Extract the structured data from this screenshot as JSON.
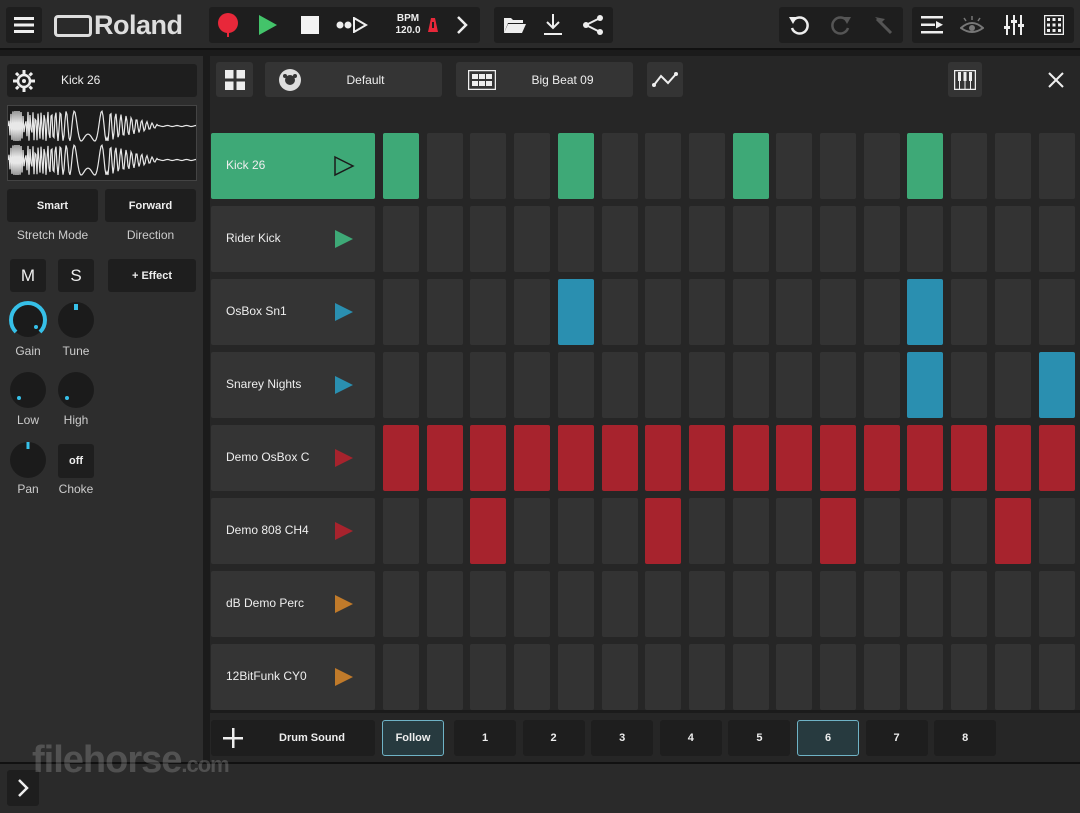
{
  "app": {
    "logo_text": "Roland"
  },
  "transport": {
    "bpm_label": "BPM",
    "bpm_value": "120.0"
  },
  "sound_panel": {
    "sample_name": "Kick 26",
    "stretch_mode_value": "Smart",
    "stretch_mode_label": "Stretch Mode",
    "direction_value": "Forward",
    "direction_label": "Direction",
    "mute_label": "M",
    "solo_label": "S",
    "effect_label": "+ Effect",
    "knobs": {
      "gain": "Gain",
      "tune": "Tune",
      "low": "Low",
      "high": "High",
      "pan": "Pan",
      "choke": "Choke"
    },
    "choke_value": "off"
  },
  "editor_header": {
    "kit_name": "Default",
    "pattern_name": "Big Beat 09"
  },
  "tracks": [
    {
      "name": "Kick 26",
      "color": "#3ea977",
      "steps": [
        1,
        0,
        0,
        0,
        1,
        0,
        0,
        0,
        1,
        0,
        0,
        0,
        1,
        0,
        0,
        0
      ],
      "cls": "on-green"
    },
    {
      "name": "Rider Kick",
      "color": "#3ea977",
      "steps": [
        0,
        0,
        0,
        0,
        0,
        0,
        0,
        0,
        0,
        0,
        0,
        0,
        0,
        0,
        0,
        0
      ],
      "cls": "on-green"
    },
    {
      "name": "OsBox Sn1",
      "color": "#2a8fb0",
      "steps": [
        0,
        0,
        0,
        0,
        1,
        0,
        0,
        0,
        0,
        0,
        0,
        0,
        1,
        0,
        0,
        0
      ],
      "cls": "on-blue"
    },
    {
      "name": "Snarey Nights",
      "color": "#2a8fb0",
      "steps": [
        0,
        0,
        0,
        0,
        0,
        0,
        0,
        0,
        0,
        0,
        0,
        0,
        1,
        0,
        0,
        1
      ],
      "cls": "on-blue"
    },
    {
      "name": "Demo OsBox C",
      "color": "#a7232d",
      "steps": [
        1,
        1,
        1,
        1,
        1,
        1,
        1,
        1,
        1,
        1,
        1,
        1,
        1,
        1,
        1,
        1
      ],
      "cls": "on-red"
    },
    {
      "name": "Demo 808 CH4",
      "color": "#a7232d",
      "steps": [
        0,
        0,
        1,
        0,
        0,
        0,
        1,
        0,
        0,
        0,
        1,
        0,
        0,
        0,
        1,
        0
      ],
      "cls": "on-red"
    },
    {
      "name": "dB Demo Perc",
      "color": "#c07a2a",
      "steps": [
        0,
        0,
        0,
        0,
        0,
        0,
        0,
        0,
        0,
        0,
        0,
        0,
        0,
        0,
        0,
        0
      ],
      "cls": "on-red"
    },
    {
      "name": "12BitFunk CY0",
      "color": "#c07a2a",
      "steps": [
        0,
        0,
        0,
        0,
        0,
        0,
        0,
        0,
        0,
        0,
        0,
        0,
        0,
        0,
        0,
        0
      ],
      "cls": "on-red"
    }
  ],
  "bottom_bar": {
    "add_label": "Drum Sound",
    "follow_label": "Follow",
    "pages": [
      "1",
      "2",
      "3",
      "4",
      "5",
      "6",
      "7",
      "8"
    ],
    "selected_page": "6"
  },
  "watermark": {
    "main": "filehorse",
    "suffix": ".com"
  },
  "colors": {
    "accent_green": "#3ea977",
    "record_red": "#e8283a",
    "play_green": "#43c46a"
  }
}
